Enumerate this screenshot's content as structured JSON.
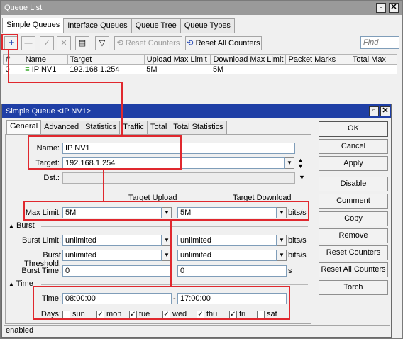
{
  "queue_list": {
    "title": "Queue List",
    "tabs": [
      "Simple Queues",
      "Interface Queues",
      "Queue Tree",
      "Queue Types"
    ],
    "toolbar": {
      "reset_counters": "Reset Counters",
      "reset_all_counters": "Reset All Counters",
      "find_placeholder": "Find"
    },
    "columns": [
      "#",
      "Name",
      "Target",
      "Upload Max Limit",
      "Download Max Limit",
      "Packet Marks",
      "Total Max"
    ],
    "rows": [
      {
        "num": "0",
        "name": "IP NV1",
        "target": "192.168.1.254",
        "upload": "5M",
        "download": "5M",
        "marks": "",
        "total": ""
      }
    ]
  },
  "dialog": {
    "title": "Simple Queue <IP NV1>",
    "tabs": [
      "General",
      "Advanced",
      "Statistics",
      "Traffic",
      "Total",
      "Total Statistics"
    ],
    "fields": {
      "name_label": "Name:",
      "name_value": "IP NV1",
      "target_label": "Target:",
      "target_value": "192.168.1.254",
      "dst_label": "Dst.:",
      "target_upload": "Target Upload",
      "target_download": "Target Download",
      "max_limit_label": "Max Limit:",
      "max_limit_up": "5M",
      "max_limit_down": "5M",
      "bits_unit": "bits/s",
      "burst_section": "Burst",
      "burst_limit_label": "Burst Limit:",
      "burst_limit_up": "unlimited",
      "burst_limit_down": "unlimited",
      "burst_threshold_label": "Burst Threshold:",
      "burst_threshold_up": "unlimited",
      "burst_threshold_down": "unlimited",
      "burst_time_label": "Burst Time:",
      "burst_time_up": "0",
      "burst_time_down": "0",
      "s_unit": "s",
      "time_section": "Time",
      "time_label": "Time:",
      "time_from": "08:00:00",
      "time_sep": "-",
      "time_to": "17:00:00",
      "days_label": "Days:",
      "days": [
        {
          "name": "sun",
          "checked": false
        },
        {
          "name": "mon",
          "checked": true
        },
        {
          "name": "tue",
          "checked": true
        },
        {
          "name": "wed",
          "checked": true
        },
        {
          "name": "thu",
          "checked": true
        },
        {
          "name": "fri",
          "checked": true
        },
        {
          "name": "sat",
          "checked": false
        }
      ]
    },
    "buttons": [
      "OK",
      "Cancel",
      "Apply",
      "Disable",
      "Comment",
      "Copy",
      "Remove",
      "Reset Counters",
      "Reset All Counters",
      "Torch"
    ],
    "status": "enabled"
  },
  "colors": {
    "highlight": "#e0282e",
    "dialog_title": "#1f3fa6",
    "enabled_icon": "#3cab2e"
  }
}
